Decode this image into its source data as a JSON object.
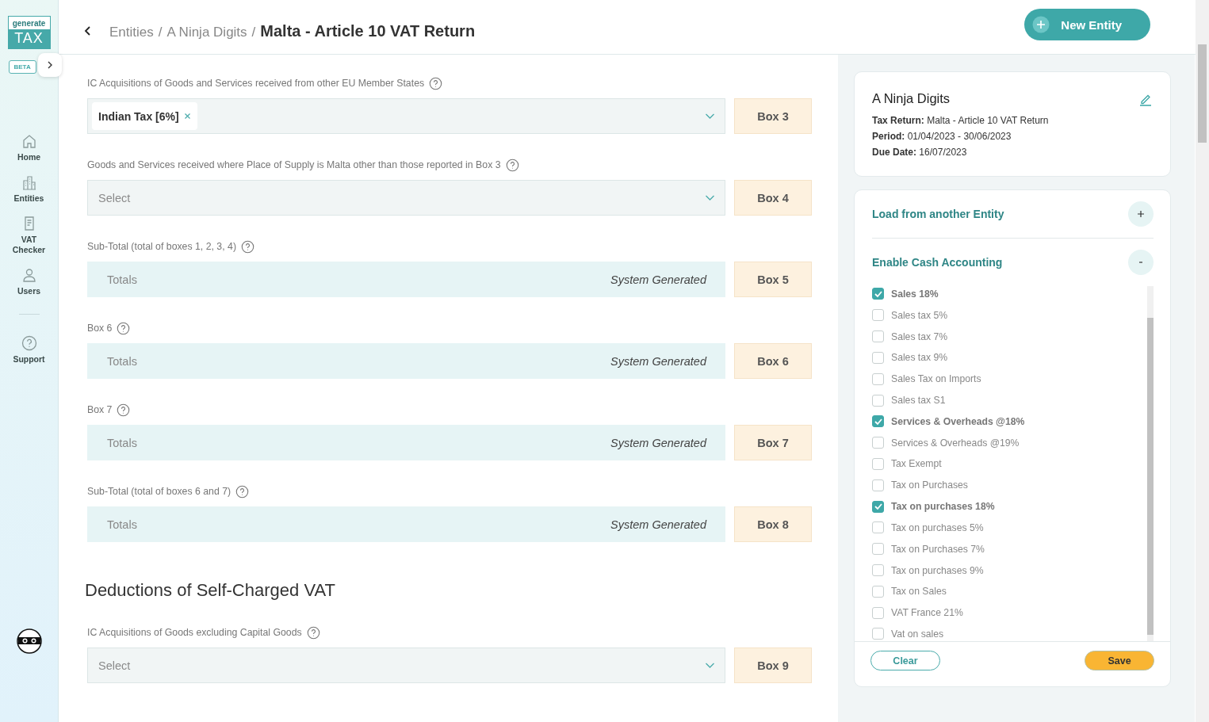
{
  "sidebar": {
    "logo": {
      "top": "generate",
      "bottom": "TAX"
    },
    "badge": "BETA",
    "nav": [
      {
        "label": "Home",
        "kind": "home"
      },
      {
        "label": "Entities",
        "kind": "buildings"
      },
      {
        "label": "VAT Checker",
        "kind": "document"
      },
      {
        "label": "Users",
        "kind": "user"
      }
    ],
    "support": {
      "label": "Support"
    }
  },
  "header": {
    "breadcrumbs": [
      "Entities",
      "A Ninja Digits"
    ],
    "separator": "/",
    "title": "Malta - Article 10 VAT Return",
    "action": "New Entity"
  },
  "form": [
    {
      "kind": "field",
      "label": "IC Acquisitions of Goods and Services received from other EU Member States",
      "input": {
        "kind": "select",
        "tags": [
          "Indian Tax [6%]"
        ]
      },
      "box": "Box 3"
    },
    {
      "kind": "field",
      "label": "Goods and Services received where Place of Supply is Malta other than those reported in Box 3",
      "input": {
        "kind": "select",
        "placeholder": "Select"
      },
      "box": "Box 4"
    },
    {
      "kind": "field",
      "label": "Sub-Total (total of boxes 1, 2, 3, 4)",
      "input": {
        "kind": "totals",
        "value": "Totals",
        "note": "System Generated"
      },
      "box": "Box 5"
    },
    {
      "kind": "field",
      "label": "Box 6",
      "input": {
        "kind": "totals",
        "value": "Totals",
        "note": "System Generated"
      },
      "box": "Box 6"
    },
    {
      "kind": "field",
      "label": "Box 7",
      "input": {
        "kind": "totals",
        "value": "Totals",
        "note": "System Generated"
      },
      "box": "Box 7"
    },
    {
      "kind": "field",
      "label": "Sub-Total (total of boxes 6 and 7)",
      "input": {
        "kind": "totals",
        "value": "Totals",
        "note": "System Generated"
      },
      "box": "Box 8"
    },
    {
      "kind": "heading",
      "text": "Deductions of Self-Charged VAT"
    },
    {
      "kind": "field",
      "label": "IC Acquisitions of Goods excluding Capital Goods",
      "input": {
        "kind": "select",
        "placeholder": "Select"
      },
      "box": "Box 9"
    }
  ],
  "entity_card": {
    "name": "A Ninja Digits",
    "details": [
      {
        "label": "Tax Return:",
        "value": "Malta - Article 10 VAT Return"
      },
      {
        "label": "Period:",
        "value": "01/04/2023 - 30/06/2023"
      },
      {
        "label": "Due Date:",
        "value": "16/07/2023"
      }
    ]
  },
  "panel": {
    "sections": [
      {
        "title": "Load from another Entity",
        "expanded": false
      },
      {
        "title": "Enable Cash Accounting",
        "expanded": true
      }
    ],
    "options": [
      {
        "label": "Sales 18%",
        "checked": true
      },
      {
        "label": "Sales tax 5%",
        "checked": false
      },
      {
        "label": "Sales tax 7%",
        "checked": false
      },
      {
        "label": "Sales tax 9%",
        "checked": false
      },
      {
        "label": "Sales Tax on Imports",
        "checked": false
      },
      {
        "label": "Sales tax S1",
        "checked": false
      },
      {
        "label": "Services & Overheads @18%",
        "checked": true
      },
      {
        "label": "Services & Overheads @19%",
        "checked": false
      },
      {
        "label": "Tax Exempt",
        "checked": false
      },
      {
        "label": "Tax on Purchases",
        "checked": false
      },
      {
        "label": "Tax on purchases 18%",
        "checked": true
      },
      {
        "label": "Tax on purchases 5%",
        "checked": false
      },
      {
        "label": "Tax on Purchases 7%",
        "checked": false
      },
      {
        "label": "Tax on purchases 9%",
        "checked": false
      },
      {
        "label": "Tax on Sales",
        "checked": false
      },
      {
        "label": "VAT France 21%",
        "checked": false
      },
      {
        "label": "Vat on sales",
        "checked": false
      }
    ],
    "buttons": {
      "clear": "Clear",
      "save": "Save"
    }
  }
}
